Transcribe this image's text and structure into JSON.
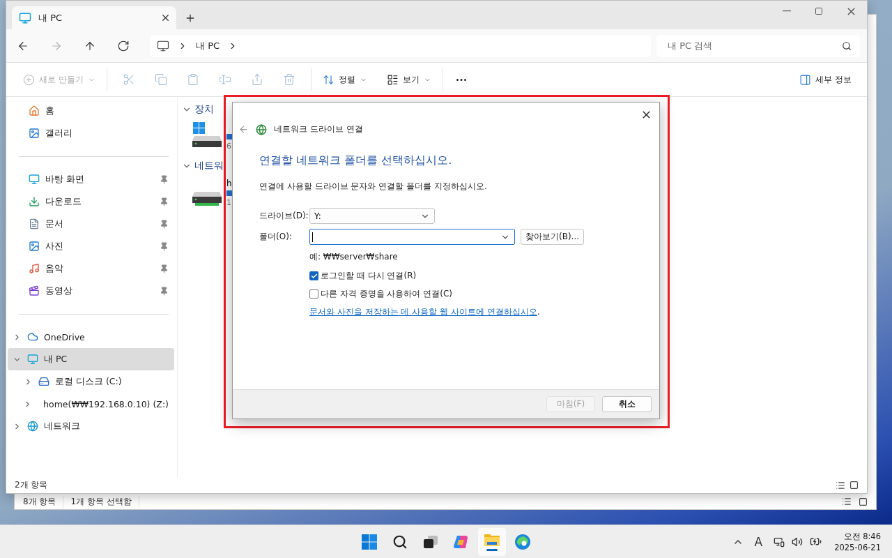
{
  "window": {
    "tabs": [
      {
        "title": "내 PC",
        "selected": true
      }
    ]
  },
  "nav": [
    {
      "kind": "back",
      "disabled": false
    },
    {
      "kind": "forward",
      "disabled": true
    },
    {
      "kind": "up",
      "disabled": false
    },
    {
      "kind": "refresh",
      "disabled": false
    }
  ],
  "address": {
    "path": [
      "내 PC"
    ]
  },
  "search": {
    "placeholder": "내 PC 검색"
  },
  "toolbar": {
    "new_item": {
      "label": "새로 만들기",
      "disabled": true
    },
    "actions": [
      {
        "kind": "cut",
        "disabled": true
      },
      {
        "kind": "copy",
        "disabled": true
      },
      {
        "kind": "paste",
        "disabled": true
      },
      {
        "kind": "rename",
        "disabled": true
      },
      {
        "kind": "share",
        "disabled": true
      },
      {
        "kind": "delete",
        "disabled": true
      }
    ],
    "sort": {
      "label": "정렬"
    },
    "view": {
      "label": "보기"
    },
    "details": {
      "label": "세부 정보"
    }
  },
  "sidebar": {
    "quick": [
      {
        "kind": "home",
        "label": "홈"
      },
      {
        "kind": "gallery",
        "label": "갤러리"
      }
    ],
    "pinned": [
      {
        "kind": "desktop",
        "label": "바탕 화면",
        "pinned": true
      },
      {
        "kind": "downloads",
        "label": "다운로드",
        "pinned": true
      },
      {
        "kind": "documents",
        "label": "문서",
        "pinned": true
      },
      {
        "kind": "pictures",
        "label": "사진",
        "pinned": true
      },
      {
        "kind": "music",
        "label": "음악",
        "pinned": true
      },
      {
        "kind": "videos",
        "label": "동영상",
        "pinned": true
      }
    ],
    "tree": [
      {
        "kind": "cloud",
        "label": "OneDrive",
        "expanded": false,
        "selected": false
      },
      {
        "kind": "pc",
        "label": "내 PC",
        "expanded": true,
        "selected": true,
        "children": [
          {
            "kind": "disk",
            "label": "로컬 디스크 (C:)",
            "expanded": false,
            "selected": false
          },
          {
            "kind": "netdrive",
            "label": "home(₩₩192.168.0.10) (Z:)",
            "expanded": false,
            "selected": false
          }
        ]
      },
      {
        "kind": "network",
        "label": "네트워크",
        "expanded": false,
        "selected": false
      }
    ]
  },
  "content": {
    "groups": [
      {
        "title": "장치",
        "expanded": true,
        "items": [
          {
            "kind": "disk",
            "size": "6"
          }
        ]
      },
      {
        "title": "네트워",
        "expanded": true,
        "items": [
          {
            "kind": "netdrive",
            "name": "h",
            "size": "1"
          }
        ]
      }
    ]
  },
  "status_bar": {
    "count": "2개 항목"
  },
  "back_window": {
    "status": [
      "8개 항목",
      "1개 항목 선택함"
    ]
  },
  "dialog": {
    "title": "네트워크 드라이브 연결",
    "heading": "연결할 네트워크 폴더를 선택하십시오.",
    "description": "연결에 사용할 드라이브 문자와 연결할 폴더를 지정하십시오.",
    "drive": {
      "label": "드라이브(D):",
      "value": "Y:"
    },
    "folder": {
      "label": "폴더(O):"
    },
    "browse": "찾아보기(B)...",
    "example": "예: ₩₩server₩share",
    "options": [
      {
        "label": "로그인할 때 다시 연결(R)",
        "checked": true
      },
      {
        "label": "다른 자격 증명을 사용하여 연결(C)",
        "checked": false
      }
    ],
    "link": {
      "text": "문서와 사진을 저장하는 데 사용할 웹 사이트에 연결하십시오",
      "suffix": "."
    },
    "buttons": [
      {
        "label": "마침(F)",
        "disabled": true,
        "default": false
      },
      {
        "label": "취소",
        "disabled": false,
        "default": true
      }
    ],
    "highlighted": true
  },
  "taskbar": {
    "apps": [
      {
        "kind": "start",
        "active": false
      },
      {
        "kind": "search",
        "active": false
      },
      {
        "kind": "taskview",
        "active": false
      },
      {
        "kind": "copilot",
        "active": false
      },
      {
        "kind": "explorer",
        "active": true
      },
      {
        "kind": "edge",
        "active": false
      }
    ],
    "ime": "A",
    "time": "오전 8:46",
    "date": "2025-06-21"
  }
}
